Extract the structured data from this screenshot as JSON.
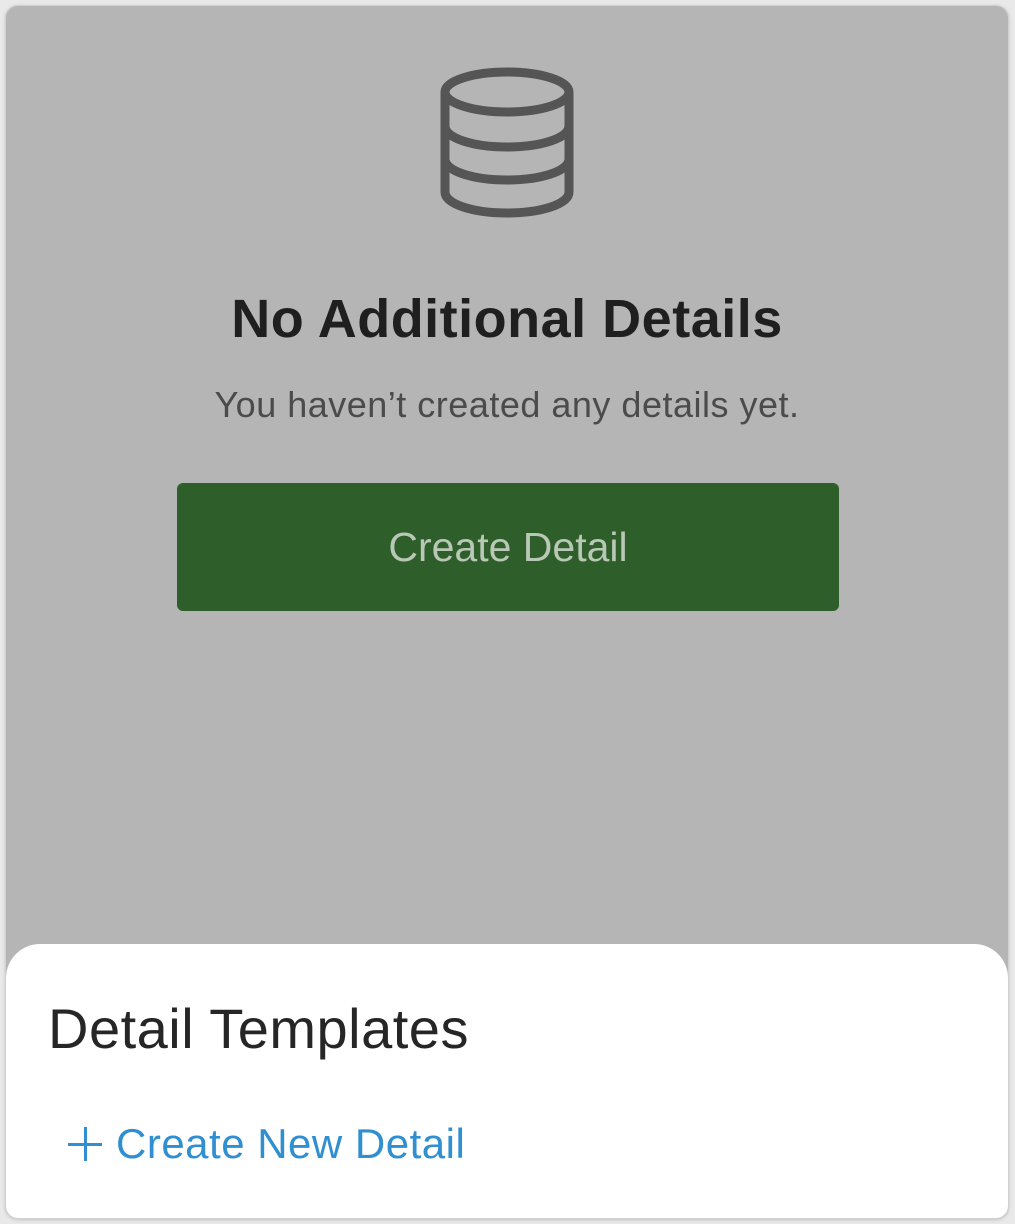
{
  "empty_state": {
    "icon": "database-icon",
    "title": "No Additional Details",
    "subtitle": "You haven’t created any details yet.",
    "button_label": "Create Detail"
  },
  "sheet": {
    "title": "Detail Templates",
    "create_link_icon": "plus-icon",
    "create_link_label": "Create New Detail"
  },
  "colors": {
    "overlay_background": "#b5b5b5",
    "primary_button": "#2e5e2a",
    "link": "#2f8fd0",
    "icon": "#555555"
  }
}
